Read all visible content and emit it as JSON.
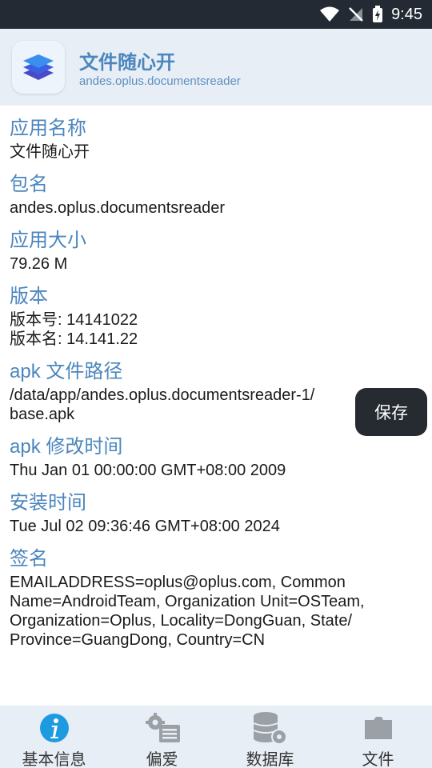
{
  "status": {
    "time": "9:45"
  },
  "app": {
    "name": "文件随心开",
    "package": "andes.oplus.documentsreader"
  },
  "info": [
    {
      "label": "应用名称",
      "lines": [
        "文件随心开"
      ]
    },
    {
      "label": "包名",
      "lines": [
        "andes.oplus.documentsreader"
      ]
    },
    {
      "label": "应用大小",
      "lines": [
        "79.26 M"
      ]
    },
    {
      "label": "版本",
      "lines": [
        "版本号: 14141022",
        "版本名: 14.141.22"
      ]
    },
    {
      "label": "apk 文件路径",
      "lines": [
        "/data/app/andes.oplus.documentsreader-1/",
        "base.apk"
      ]
    },
    {
      "label": "apk 修改时间",
      "lines": [
        "Thu Jan 01 00:00:00 GMT+08:00 2009"
      ]
    },
    {
      "label": "安装时间",
      "lines": [
        "Tue Jul 02 09:36:46 GMT+08:00 2024"
      ]
    },
    {
      "label": "签名",
      "lines": [
        "EMAILADDRESS=oplus@oplus.com, Common",
        "Name=AndroidTeam, Organization Unit=OSTeam,",
        "Organization=Oplus, Locality=DongGuan, State/",
        "Province=GuangDong, Country=CN"
      ]
    }
  ],
  "save_label": "保存",
  "nav": [
    {
      "label": "基本信息",
      "icon": "info-icon",
      "color": "#1e9be0"
    },
    {
      "label": "偏爱",
      "icon": "settings-list-icon",
      "color": "#9aa0a6"
    },
    {
      "label": "数据库",
      "icon": "database-gear-icon",
      "color": "#9aa0a6"
    },
    {
      "label": "文件",
      "icon": "folder-icon",
      "color": "#9aa0a6"
    }
  ]
}
